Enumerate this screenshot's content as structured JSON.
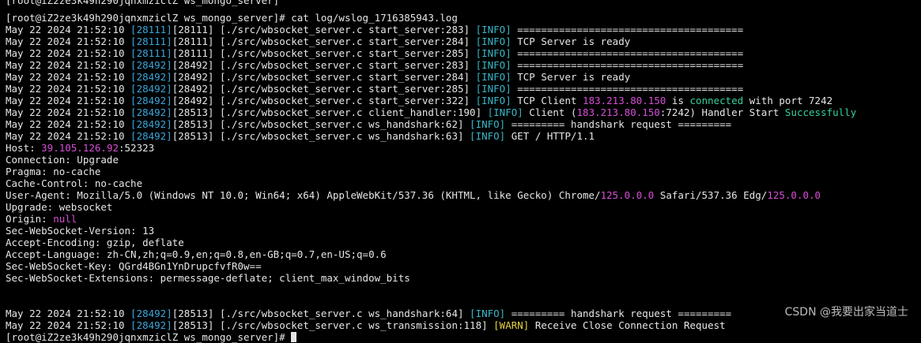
{
  "window": {
    "top_cut_line": "[root@iZ2ze3k49h290jqnxmziclZ ws_mongo_server]",
    "prompt": "[root@iZ2ze3k49h290jqnxmziclZ ws_mongo_server]# cat log/wslog_1716385943.log",
    "bottom_cut_line": "[root@iZ2ze3k49h290jqnxmziclZ ws_mongo_server]# "
  },
  "log_lines": [
    {
      "ts": "May 22 2024 21:52:10 ",
      "pid": "28111",
      "tid": "[28111]",
      "src": " [./src/wbsocket_server.c start_server:283] ",
      "lvl": "[INFO]",
      "msg": " ======================================"
    },
    {
      "ts": "May 22 2024 21:52:10 ",
      "pid": "28111",
      "tid": "[28111]",
      "src": " [./src/wbsocket_server.c start_server:284] ",
      "lvl": "[INFO]",
      "msg": " TCP Server is ready"
    },
    {
      "ts": "May 22 2024 21:52:10 ",
      "pid": "28111",
      "tid": "[28111]",
      "src": " [./src/wbsocket_server.c start_server:285] ",
      "lvl": "[INFO]",
      "msg": " ======================================"
    },
    {
      "ts": "May 22 2024 21:52:10 ",
      "pid": "28492",
      "tid": "[28492]",
      "src": " [./src/wbsocket_server.c start_server:283] ",
      "lvl": "[INFO]",
      "msg": " ======================================"
    },
    {
      "ts": "May 22 2024 21:52:10 ",
      "pid": "28492",
      "tid": "[28492]",
      "src": " [./src/wbsocket_server.c start_server:284] ",
      "lvl": "[INFO]",
      "msg": " TCP Server is ready"
    },
    {
      "ts": "May 22 2024 21:52:10 ",
      "pid": "28492",
      "tid": "[28492]",
      "src": " [./src/wbsocket_server.c start_server:285] ",
      "lvl": "[INFO]",
      "msg": " ======================================"
    }
  ],
  "line_connected": {
    "ts": "May 22 2024 21:52:10 ",
    "pid": "28492",
    "tid": "[28492]",
    "src": " [./src/wbsocket_server.c start_server:322] ",
    "lvl": "[INFO]",
    "pre": " TCP Client ",
    "ip": "183.213.80.150",
    "mid": " is ",
    "word": "connected",
    "post": " with port 7242"
  },
  "line_handler": {
    "ts": "May 22 2024 21:52:10 ",
    "pid": "28492",
    "tid": "[28513]",
    "src": " [./src/wbsocket_server.c client_handler:190] ",
    "lvl": "[INFO]",
    "pre": " Client (",
    "ip": "183.213.80.150",
    "mid": ":7242) Handler Start ",
    "word": "Successfully"
  },
  "line_hs62": {
    "ts": "May 22 2024 21:52:10 ",
    "pid": "28492",
    "tid": "[28513]",
    "src": " [./src/wbsocket_server.c ws_handshark:62] ",
    "lvl": "[INFO]",
    "msg": " ========= handshark request ========="
  },
  "line_hs63": {
    "ts": "May 22 2024 21:52:10 ",
    "pid": "28492",
    "tid": "[28513]",
    "src": " [./src/wbsocket_server.c ws_handshark:63] ",
    "lvl": "[INFO]",
    "msg": " GET / HTTP/1.1"
  },
  "headers": {
    "host_pre": "Host: ",
    "host_ip": "39.105.126.92",
    "host_port": ":52323",
    "connection": "Connection: Upgrade",
    "pragma": "Pragma: no-cache",
    "cache_control": "Cache-Control: no-cache",
    "ua_a": "User-Agent: Mozilla/5.0 (Windows NT 10.0; Win64; x64) AppleWebKit/537.36 (KHTML, like Gecko) Chrome/",
    "ua_v1": "125.0.0.0",
    "ua_b": " Safari/537.36 Edg/",
    "ua_v2": "125.0.0.0",
    "upgrade": "Upgrade: websocket",
    "origin_pre": "Origin: ",
    "origin_val": "null",
    "ws_version": "Sec-WebSocket-Version: 13",
    "accept_encoding": "Accept-Encoding: gzip, deflate",
    "accept_language": "Accept-Language: zh-CN,zh;q=0.9,en;q=0.8,en-GB;q=0.7,en-US;q=0.6",
    "ws_key": "Sec-WebSocket-Key: QGrd4BGn1YnDrupcfvfR0w==",
    "ws_extensions": "Sec-WebSocket-Extensions: permessage-deflate; client_max_window_bits"
  },
  "line_hs64": {
    "ts": "May 22 2024 21:52:10 ",
    "pid": "28492",
    "tid": "[28513]",
    "src": " [./src/wbsocket_server.c ws_handshark:64] ",
    "lvl": "[INFO]",
    "msg": " ========= handshark request ========="
  },
  "line_tx118": {
    "ts": "May 22 2024 21:52:10 ",
    "pid": "28492",
    "tid": "[28513]",
    "src": " [./src/wbsocket_server.c ws_transmission:118] ",
    "lvl": "[WARN]",
    "msg": " Receive Close Connection Request"
  },
  "watermark": "CSDN @我要出家当道士",
  "colors": {
    "background": "#000000",
    "text": "#e6e6e6",
    "pid": "#3aa6d9",
    "info": "#39b7c7",
    "ip": "#d54fd6",
    "success": "#37d09a",
    "warn": "#e5d23f"
  }
}
